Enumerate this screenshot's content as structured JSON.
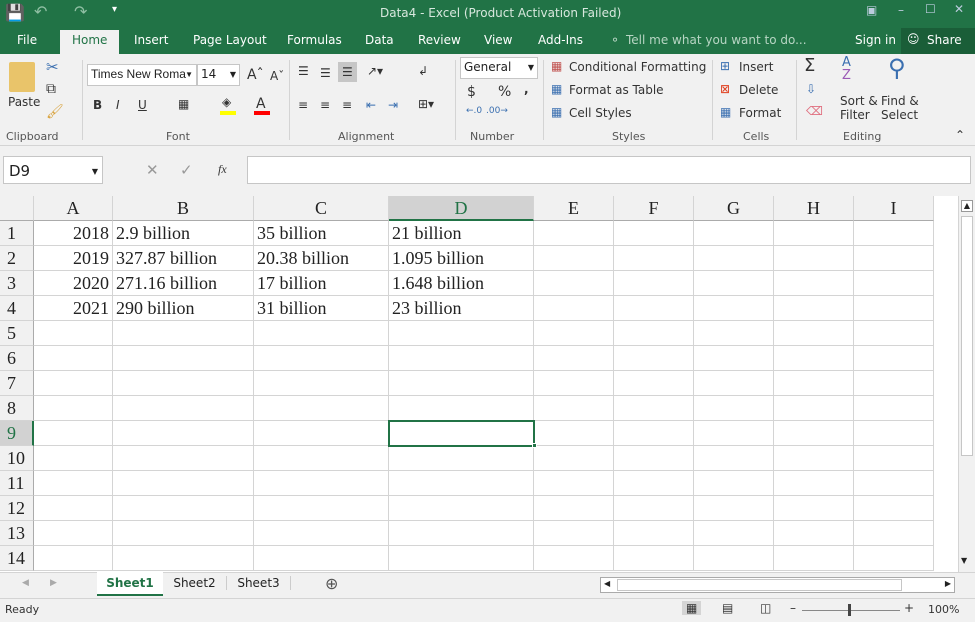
{
  "title": "Data4 - Excel (Product Activation Failed)",
  "qat": {
    "save": "save-icon",
    "undo": "undo-icon",
    "redo": "redo-icon"
  },
  "tabs": [
    "File",
    "Home",
    "Insert",
    "Page Layout",
    "Formulas",
    "Data",
    "Review",
    "View",
    "Add-Ins"
  ],
  "tell_me": "Tell me what you want to do...",
  "sign_in": "Sign in",
  "share": "Share",
  "ribbon": {
    "clipboard": {
      "paste": "Paste",
      "label": "Clipboard"
    },
    "font": {
      "name": "Times New Roma",
      "size": "14",
      "label": "Font",
      "bold": "B",
      "italic": "I",
      "underline": "U",
      "fill_color": "#ffff00",
      "font_color": "#ff0000"
    },
    "alignment": {
      "label": "Alignment"
    },
    "number": {
      "format": "General",
      "currency": "$",
      "percent": "%",
      "comma": ",",
      "label": "Number"
    },
    "styles": {
      "conditional": "Conditional Formatting",
      "format_table": "Format as Table",
      "cell_styles": "Cell Styles",
      "label": "Styles"
    },
    "cells": {
      "insert": "Insert",
      "delete": "Delete",
      "format": "Format",
      "label": "Cells"
    },
    "editing": {
      "sort1": "Sort &",
      "sort2": "Filter",
      "find1": "Find &",
      "find2": "Select",
      "label": "Editing"
    }
  },
  "name_box": "D9",
  "fx": "fx",
  "formula": "",
  "columns": [
    "A",
    "B",
    "C",
    "D",
    "E",
    "F",
    "G",
    "H",
    "I"
  ],
  "rows": [
    [
      "2018",
      "2.9 billion",
      "35 billion",
      "21 billion"
    ],
    [
      "2019",
      "327.87 billion",
      "20.38 billion",
      "1.095 billion"
    ],
    [
      "2020",
      "271.16 billion",
      "17 billion",
      "1.648 billion"
    ],
    [
      "2021",
      "290 billion",
      "31 billion",
      "23 billion"
    ]
  ],
  "row_numbers": [
    "1",
    "2",
    "3",
    "4",
    "5",
    "6",
    "7",
    "8",
    "9",
    "10",
    "11",
    "12",
    "13",
    "14"
  ],
  "selected_cell": "D9",
  "sheets": [
    "Sheet1",
    "Sheet2",
    "Sheet3"
  ],
  "active_sheet": "Sheet1",
  "status": "Ready",
  "zoom": "100%",
  "accent": "#217346"
}
